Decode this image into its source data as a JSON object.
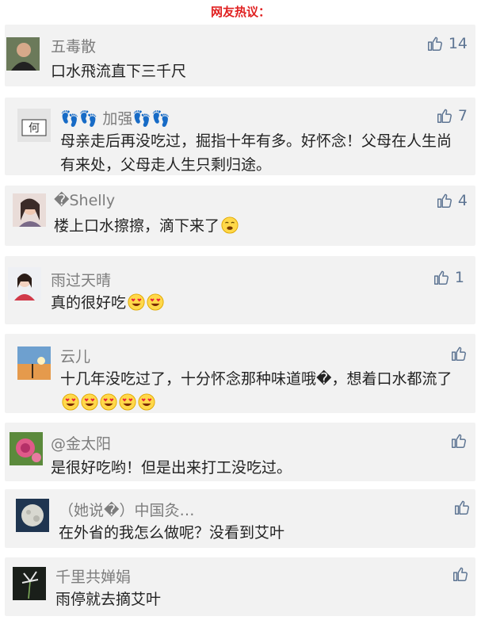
{
  "header": {
    "title": "网友热议："
  },
  "comments": [
    {
      "name": "五毒散",
      "text": "口水飛流直下三千尺",
      "likes": "14"
    },
    {
      "name": "👣👣 加强👣👣",
      "text": "母亲走后再没吃过，掘指十年有多。好怀念！父母在人生尚有来处，父母走人生只剩归途。",
      "likes": "7"
    },
    {
      "name": "�Shelly",
      "text": "楼上口水擦擦，滴下来了",
      "likes": "4"
    },
    {
      "name": "雨过天晴",
      "text": "真的很好吃",
      "likes": "1"
    },
    {
      "name": "云儿",
      "text": "十几年没吃过了，十分怀念那种味道哦�，想着口水都流了",
      "likes": ""
    },
    {
      "name": "@金太阳",
      "text": "是很好吃哟！但是出来打工没吃过。",
      "likes": ""
    },
    {
      "name": "（她说�）中国灸…",
      "text": "在外省的我怎么做呢？没看到艾叶",
      "likes": ""
    },
    {
      "name": "千里共婵娟",
      "text": "雨停就去摘艾叶",
      "likes": ""
    }
  ],
  "icons": {
    "like": "thumbs-up-icon",
    "emoji_drool": "drool-emoji-icon",
    "emoji_heart_eyes": "heart-eyes-emoji-icon"
  },
  "colors": {
    "header": "#e02020",
    "card_bg": "#f2f2f2",
    "like": "#5e7593",
    "name": "#7d7d7d"
  }
}
